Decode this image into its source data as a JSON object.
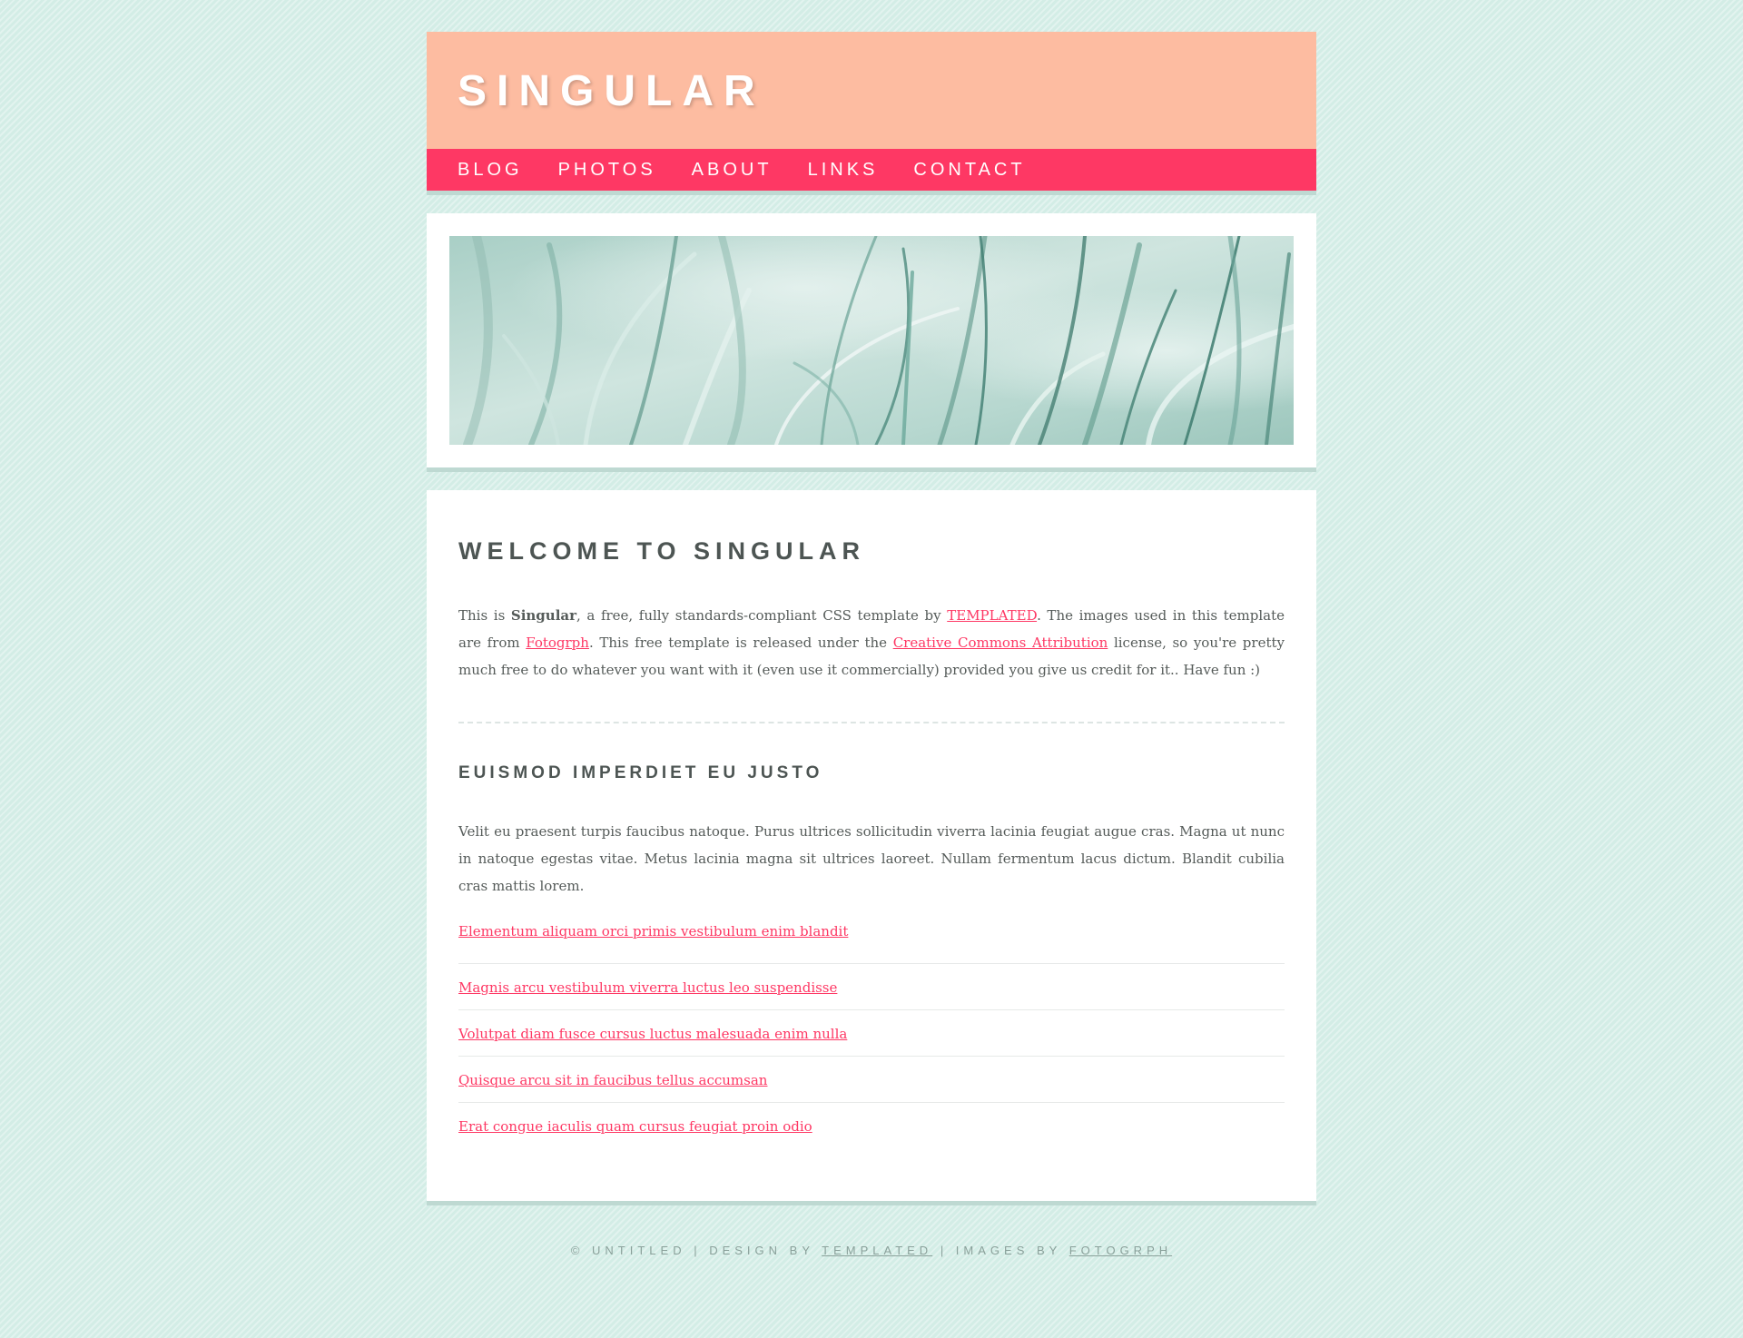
{
  "site": {
    "title": "SINGULAR"
  },
  "nav": {
    "items": [
      {
        "label": "BLOG"
      },
      {
        "label": "PHOTOS"
      },
      {
        "label": "ABOUT"
      },
      {
        "label": "LINKS"
      },
      {
        "label": "CONTACT"
      }
    ]
  },
  "welcome": {
    "title": "WELCOME TO SINGULAR",
    "intro_parts": {
      "p1": "This is ",
      "brand": "Singular",
      "p2": ", a free, fully standards-compliant CSS template by ",
      "link1": "TEMPLATED",
      "p3": ". The images used in this template are from ",
      "link2": "Fotogrph",
      "p4": ". This free template is released under the ",
      "link3": "Creative Commons Attribution",
      "p5": " license, so you're pretty much free to do whatever you want with it (even use it commercially) provided you give us credit for it.. Have fun :)"
    }
  },
  "section": {
    "title": "EUISMOD IMPERDIET EU JUSTO",
    "body": "Velit eu praesent turpis faucibus natoque. Purus ultrices sollicitudin viverra lacinia feugiat augue cras. Magna ut nunc in natoque egestas vitae. Metus lacinia magna sit ultrices laoreet. Nullam fermentum lacus dictum. Blandit cubilia cras mattis lorem.",
    "links": [
      "Elementum aliquam orci primis vestibulum enim blandit",
      "Magnis arcu vestibulum viverra luctus leo suspendisse",
      "Volutpat diam fusce cursus luctus malesuada enim nulla",
      "Quisque arcu sit in faucibus tellus accumsan",
      "Erat congue iaculis quam cursus feugiat proin odio"
    ]
  },
  "footer": {
    "copyright": "© UNTITLED | DESIGN BY ",
    "design_link": "TEMPLATED",
    "images_text": " | IMAGES BY ",
    "images_link": "FOTOGRPH"
  },
  "colors": {
    "header_bg": "#fdbca1",
    "nav_bg": "#fe3864",
    "link": "#fe3864",
    "page_bg": "#d3ede6"
  }
}
